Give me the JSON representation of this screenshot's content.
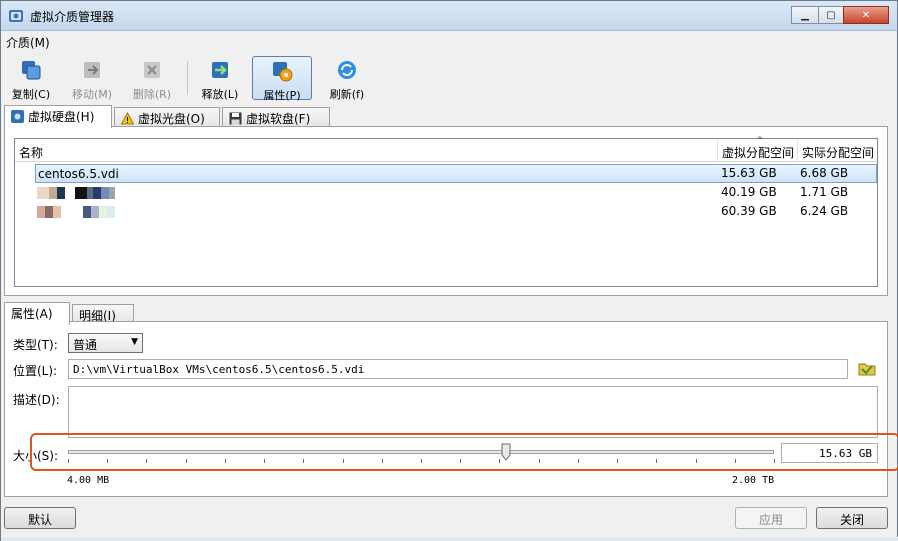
{
  "window": {
    "title": "虚拟介质管理器"
  },
  "menu": {
    "media_label": "介质(M)"
  },
  "toolbar": {
    "copy": "复制(C)",
    "move": "移动(M)",
    "delete": "删除(R)",
    "release": "释放(L)",
    "properties": "属性(P)",
    "refresh": "刷新(f)"
  },
  "tabs": {
    "hard_disk": "虚拟硬盘(H)",
    "optical": "虚拟光盘(O)",
    "floppy": "虚拟软盘(F)"
  },
  "table": {
    "headers": {
      "name": "名称",
      "virtual_size": "虚拟分配空间",
      "actual_size": "实际分配空间"
    },
    "rows": [
      {
        "name": "centos6.5.vdi",
        "virtual_size": "15.63 GB",
        "actual_size": "6.68 GB"
      },
      {
        "name": "",
        "virtual_size": "40.19 GB",
        "actual_size": "1.71 GB"
      },
      {
        "name": "",
        "virtual_size": "60.39 GB",
        "actual_size": "6.24 GB"
      }
    ]
  },
  "details": {
    "tab_properties": "属性(A)",
    "tab_info": "明细(I)",
    "type_label": "类型(T):",
    "type_value": "普通",
    "location_label": "位置(L):",
    "location_value": "D:\\vm\\VirtualBox VMs\\centos6.5\\centos6.5.vdi",
    "description_label": "描述(D):",
    "size_label": "大小(S):",
    "size_value": "15.63 GB",
    "size_min": "4.00 MB",
    "size_max": "2.00 TB",
    "slider_position": 0.62
  },
  "buttons": {
    "reset": "默认",
    "apply": "应用",
    "close": "关闭"
  },
  "colors": {
    "highlight": "#e2541f",
    "selection": "#cde3fa"
  }
}
